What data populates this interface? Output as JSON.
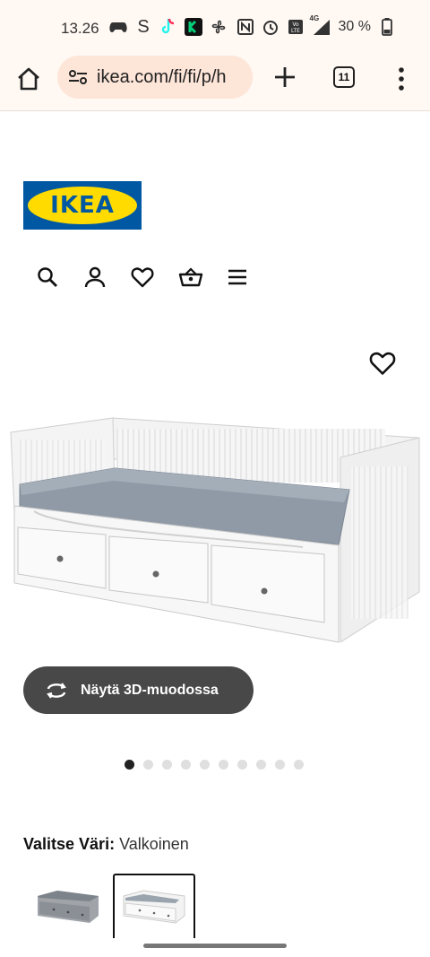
{
  "status_bar": {
    "time": "13.26",
    "network": "4G",
    "battery": "30 %",
    "icons": [
      "game-controller-icon",
      "s-app-icon",
      "tiktok-icon",
      "kickstarter-icon",
      "fan-icon",
      "nfc-icon",
      "alarm-icon",
      "volte-icon",
      "signal-icon",
      "battery-icon"
    ]
  },
  "browser": {
    "url": "ikea.com/fi/fi/p/h",
    "tab_count": "11"
  },
  "brand": {
    "logo_text": "IKEA",
    "logo_blue": "#0058a3",
    "logo_yellow": "#ffdb00"
  },
  "nav": {
    "icons": [
      "search-icon",
      "account-icon",
      "wishlist-icon",
      "basket-icon",
      "menu-icon"
    ]
  },
  "product": {
    "view_3d_label": "Näytä 3D-muodossa",
    "carousel": {
      "total": 10,
      "active": 1
    },
    "color_prompt": "Valitse Väri:",
    "color_value": "Valkoinen",
    "swatches": [
      {
        "name": "grey",
        "selected": false
      },
      {
        "name": "white",
        "selected": true
      }
    ]
  }
}
